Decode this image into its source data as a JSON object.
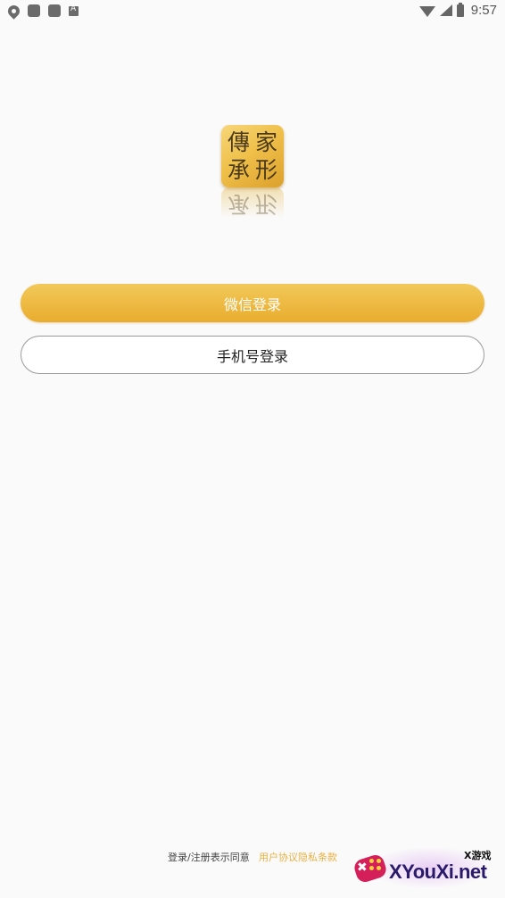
{
  "status_bar": {
    "time": "9:57",
    "left_icons": [
      "location-icon",
      "notification-icon",
      "notification-icon",
      "app-icon"
    ],
    "right_icons": [
      "wifi-icon",
      "cell-signal-icon",
      "battery-icon"
    ]
  },
  "logo": {
    "chars": [
      "傳",
      "家",
      "承",
      "形"
    ],
    "reflection_chars": [
      "承",
      "形"
    ],
    "colors": {
      "gold_light": "#f7d67a",
      "gold_dark": "#dca02c",
      "ink": "#4a3a1a"
    }
  },
  "buttons": {
    "wechat_login": "微信登录",
    "phone_login": "手机号登录"
  },
  "footer": {
    "prefix": "登录/注册表示同意",
    "user_agreement": "用户协议",
    "privacy_policy": "隐私条款"
  },
  "watermark": {
    "small_text": "X游戏",
    "big_text": "XYouXi.net"
  },
  "colors": {
    "accent": "#e9ac2e",
    "link": "#e8b142",
    "background": "#fafafa"
  }
}
